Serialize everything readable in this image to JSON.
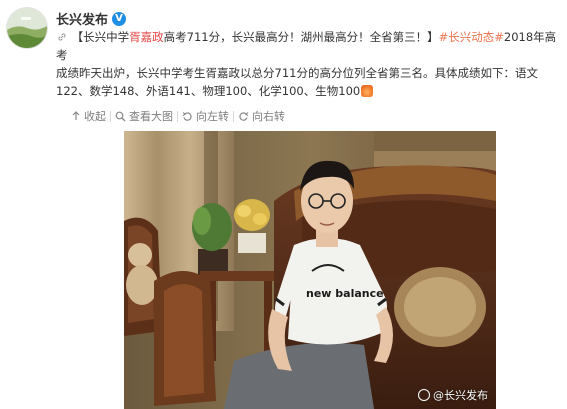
{
  "account": {
    "name": "长兴发布",
    "verified_badge": "V"
  },
  "post": {
    "line1_prefix": "【长兴中学",
    "student_name": "胥嘉政",
    "line1_rest": "高考711分，长兴最高分！湖州最高分！全省第三！】",
    "topic": "#长兴动态#",
    "line1_tail": "2018年高考",
    "line2": "成绩昨天出炉，长兴中学考生胥嘉政以总分711分的高分位列全省第三名。具体成绩如下：语文",
    "line3": "122、数学148、外语141、物理100、化学100、生物100"
  },
  "toolbar": {
    "collapse": "收起",
    "view_large": "查看大图",
    "rotate_left": "向左转",
    "rotate_right": "向右转"
  },
  "photo": {
    "shirt_logo_text": "new balance",
    "watermark": "@长兴发布"
  },
  "icons": {
    "account_avatar": "landscape-avatar",
    "verified": "verified-v-icon",
    "link": "link-icon",
    "collapse": "collapse-arrow-icon",
    "magnify": "magnify-icon",
    "rotate_left": "rotate-left-icon",
    "rotate_right": "rotate-right-icon",
    "emoji": "flame-emoji-icon",
    "weibo_logo": "weibo-logo-icon"
  },
  "colors": {
    "link": "#eb7350",
    "verified": "#1f8fe5",
    "toolbar_text": "#7d7d7d"
  }
}
